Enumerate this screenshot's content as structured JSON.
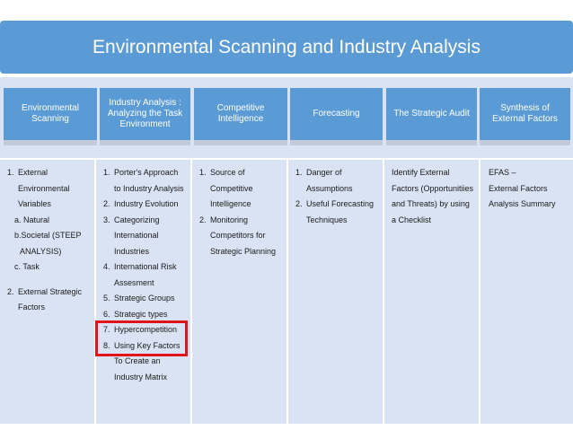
{
  "title": "Environmental Scanning and Industry Analysis",
  "phases": [
    "Environmental Scanning",
    "Industry Analysis : Analyzing the Task Environment",
    "Competitive Intelligence",
    "Forecasting",
    "The Strategic Audit",
    "Synthesis of External Factors"
  ],
  "col1": {
    "item1": "External Environmental Variables",
    "sub_a": "a. Natural",
    "sub_b": "b.Societal (STEEP",
    "sub_b2": "ANALYSIS)",
    "sub_c": "c.  Task",
    "item2": "External Strategic Factors"
  },
  "col2": [
    "Porter's Approach to Industry Analysis",
    "Industry Evolution",
    "Categorizing International Industries",
    "International Risk Assesment",
    "Strategic Groups",
    "Strategic types",
    "Hypercompetition",
    "Using Key Factors To Create an Industry Matrix"
  ],
  "col3": [
    "Source of Competitive Intelligence",
    "Monitoring Competitors for Strategic Planning"
  ],
  "col4": [
    "Danger of Assumptions",
    "Useful Forecasting Techniques"
  ],
  "col5": "Identify External Factors (Opportunitiies and Threats) by using a Checklist",
  "col6": "EFAS –\nExternal Factors Analysis Summary",
  "colors": {
    "header_blue": "#5b9bd5",
    "panel_blue": "#dae3f3",
    "highlight_red": "#e0141a"
  }
}
